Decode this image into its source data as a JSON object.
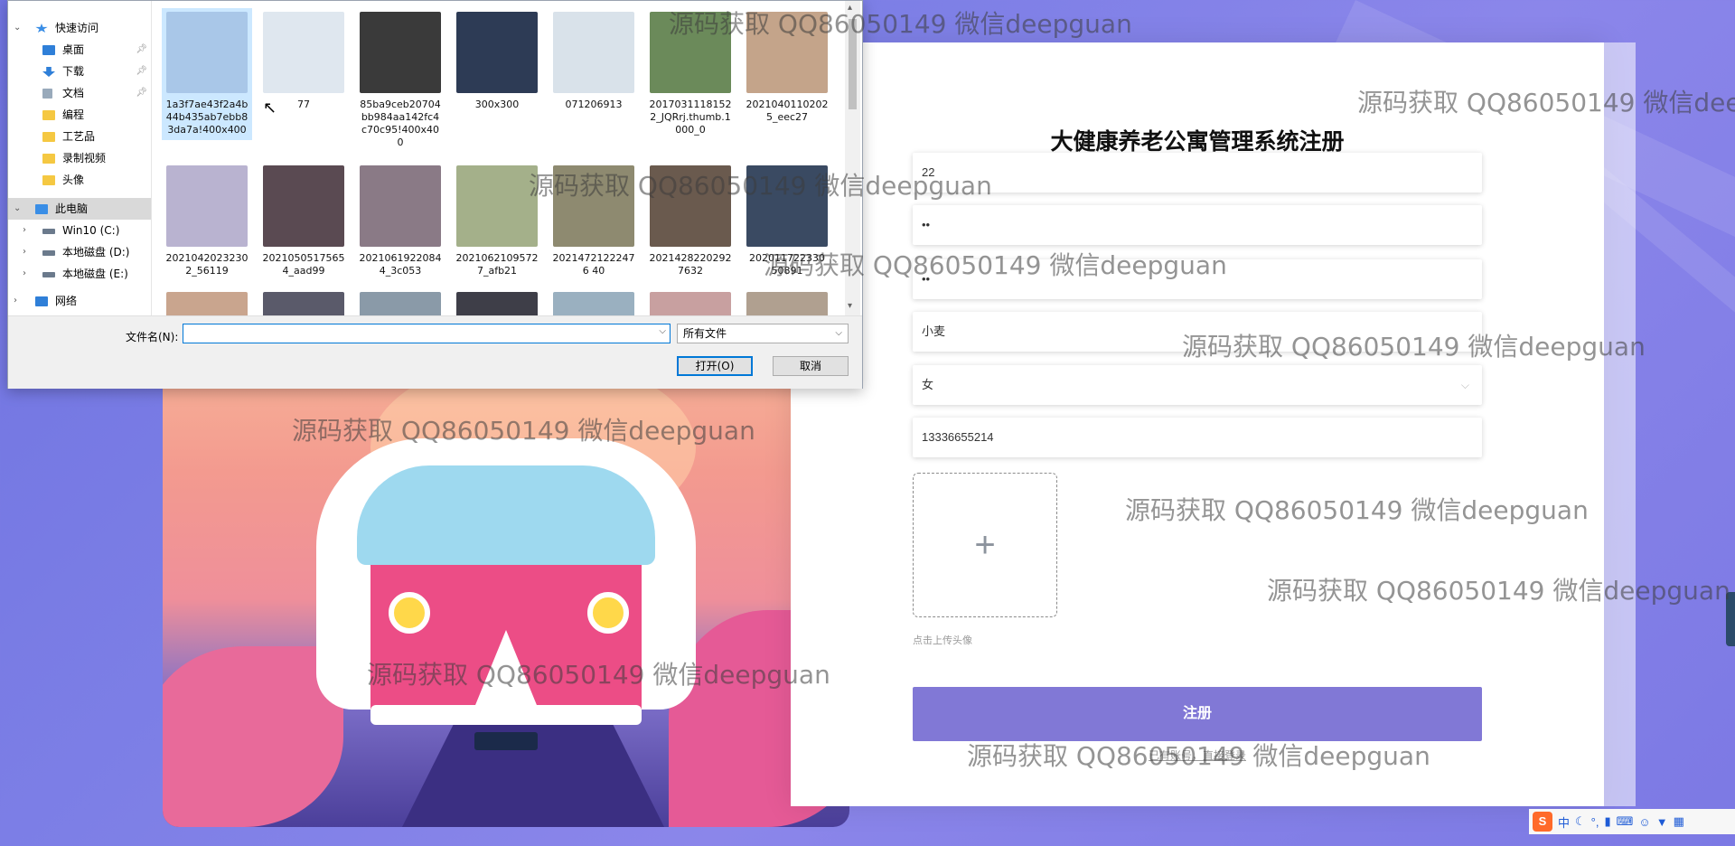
{
  "form": {
    "title": "大健康养老公寓管理系统注册",
    "fields": [
      {
        "name": "account",
        "value": "22"
      },
      {
        "name": "password",
        "value": "••"
      },
      {
        "name": "confirm_password",
        "value": "••"
      },
      {
        "name": "name",
        "value": "小麦"
      },
      {
        "name": "gender",
        "value": "女"
      },
      {
        "name": "phone",
        "value": "13336655214"
      }
    ],
    "upload_hint": "点击上传头像",
    "upload_icon": "plus-icon",
    "submit_label": "注册",
    "login_link": "已有账号，直接登录",
    "accent_color": "#8178d6"
  },
  "watermark": "源码获取 QQ86050149 微信deepguan",
  "dialog": {
    "nav": [
      {
        "label": "快速访问",
        "icon": "star-icon",
        "expand": "open"
      },
      {
        "label": "桌面",
        "icon": "desktop-icon",
        "pinned": true
      },
      {
        "label": "下载",
        "icon": "download-icon",
        "pinned": true
      },
      {
        "label": "文档",
        "icon": "document-icon",
        "pinned": true
      },
      {
        "label": "编程",
        "icon": "folder-icon"
      },
      {
        "label": "工艺品",
        "icon": "folder-icon"
      },
      {
        "label": "录制视频",
        "icon": "folder-icon"
      },
      {
        "label": "头像",
        "icon": "folder-icon"
      },
      {
        "label": "此电脑",
        "icon": "computer-icon",
        "expand": "open",
        "selected": true
      },
      {
        "label": "Win10 (C:)",
        "icon": "drive-icon",
        "expand": "closed"
      },
      {
        "label": "本地磁盘 (D:)",
        "icon": "drive-icon",
        "expand": "closed"
      },
      {
        "label": "本地磁盘 (E:)",
        "icon": "drive-icon",
        "expand": "closed"
      },
      {
        "label": "网络",
        "icon": "network-icon",
        "expand": "closed"
      }
    ],
    "files": [
      {
        "name": "1a3f7ae43f2a4b44b435ab7ebb83da7a!400x400",
        "selected": true
      },
      {
        "name": "77"
      },
      {
        "name": "85ba9ceb20704bb984aa142fc4c70c95!400x400"
      },
      {
        "name": "300x300"
      },
      {
        "name": "071206913"
      },
      {
        "name": "20170311181522_JQRrj.thumb.1000_0"
      },
      {
        "name": "20210401102025_eec27"
      },
      {
        "name": "20210420232302_56119"
      },
      {
        "name": "20210505175654_aad99"
      },
      {
        "name": "20210619220844_3c053"
      },
      {
        "name": "20210621095727_afb21"
      },
      {
        "name": "20214721222476 40"
      },
      {
        "name": "20214282202927632"
      },
      {
        "name": "202011722330 50891"
      },
      {
        "name": ""
      },
      {
        "name": ""
      },
      {
        "name": ""
      },
      {
        "name": ""
      },
      {
        "name": ""
      },
      {
        "name": ""
      },
      {
        "name": ""
      }
    ],
    "filename_label": "文件名(N):",
    "filename_value": "",
    "filetype": "所有文件",
    "open_label": "打开(O)",
    "cancel_label": "取消"
  },
  "tray": {
    "ime": "中",
    "items": [
      "moon-icon",
      "punct-icon",
      "mic-icon",
      "keyboard-icon",
      "user-icon",
      "shirt-icon",
      "grid-icon"
    ]
  }
}
